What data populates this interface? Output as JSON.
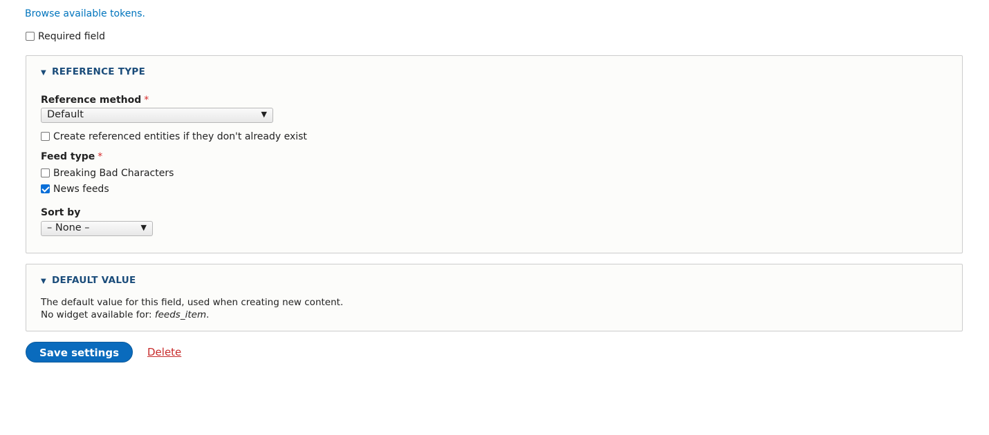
{
  "browse_tokens": "Browse available tokens.",
  "required_field": {
    "label": "Required field",
    "checked": false
  },
  "reference_type": {
    "legend": "REFERENCE TYPE",
    "method_label": "Reference method",
    "method_value": "Default",
    "create_label": "Create referenced entities if they don't already exist",
    "feed_type_label": "Feed type",
    "feed_types": [
      {
        "label": "Breaking Bad Characters",
        "checked": false
      },
      {
        "label": "News feeds",
        "checked": true
      }
    ],
    "sort_label": "Sort by",
    "sort_value": "– None –"
  },
  "default_value": {
    "legend": "DEFAULT VALUE",
    "desc": "The default value for this field, used when creating new content.",
    "no_widget": "No widget available for: ",
    "no_widget_type": "feeds_item",
    "period": "."
  },
  "actions": {
    "save": "Save settings",
    "delete": "Delete"
  },
  "required_marker": "*",
  "colors": {
    "link": "#0074bd",
    "primary": "#0a6bbd",
    "danger": "#c72a2a",
    "legend": "#1a4c7a"
  }
}
